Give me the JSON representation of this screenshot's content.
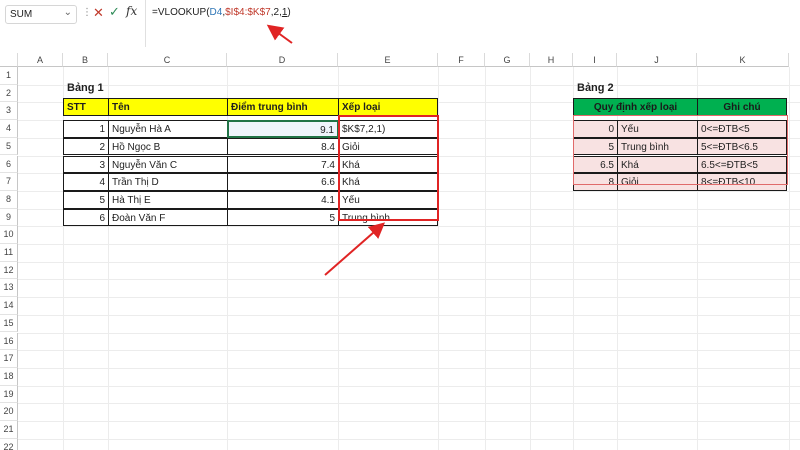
{
  "formula_bar": {
    "name_box": "SUM",
    "formula_parts": {
      "prefix": "=VLOOKUP(",
      "ref1": "D4",
      "sep1": ",",
      "ref2": "$I$4:$K$7",
      "sep2": ",",
      "index": "2",
      "sep3": ",",
      "flag": "1",
      "suffix": ")"
    }
  },
  "columns": [
    "A",
    "B",
    "C",
    "D",
    "E",
    "F",
    "G",
    "H",
    "I",
    "J",
    "K"
  ],
  "rows": [
    "1",
    "2",
    "3",
    "4",
    "5",
    "6",
    "7",
    "8",
    "9",
    "10",
    "11",
    "12",
    "13",
    "14",
    "15",
    "16",
    "17",
    "18",
    "19",
    "20",
    "21",
    "22"
  ],
  "table1": {
    "title": "Bảng 1",
    "headers": [
      "STT",
      "Tên",
      "Điểm trung bình",
      "Xếp loại"
    ],
    "rows": [
      [
        "1",
        "Nguyễn Hà A",
        "9.1",
        "$K$7,2,1)"
      ],
      [
        "2",
        "Hồ Ngọc B",
        "8.4",
        "Giỏi"
      ],
      [
        "3",
        "Nguyễn Văn C",
        "7.4",
        "Khá"
      ],
      [
        "4",
        "Trần Thị D",
        "6.6",
        "Khá"
      ],
      [
        "5",
        "Hà Thị E",
        "4.1",
        "Yếu"
      ],
      [
        "6",
        "Đoàn Văn F",
        "5",
        "Trung bình"
      ]
    ]
  },
  "table2": {
    "title": "Bảng 2",
    "headers": [
      "Quy định xếp loại",
      "Ghi chú"
    ],
    "rows": [
      [
        "0",
        "Yếu",
        "0<=ĐTB<5"
      ],
      [
        "5",
        "Trung bình",
        "5<=ĐTB<6.5"
      ],
      [
        "6.5",
        "Khá",
        "6.5<=ĐTB<5"
      ],
      [
        "8",
        "Giỏi",
        "8<=ĐTB<10"
      ]
    ]
  },
  "colors": {
    "table1_header": "#ffff00",
    "table2_header": "#00b050",
    "table2_body": "#f8e2e2",
    "annotation": "#e02424"
  },
  "icons": {
    "cancel": "close-icon",
    "enter": "check-icon",
    "function": "fx-icon"
  }
}
